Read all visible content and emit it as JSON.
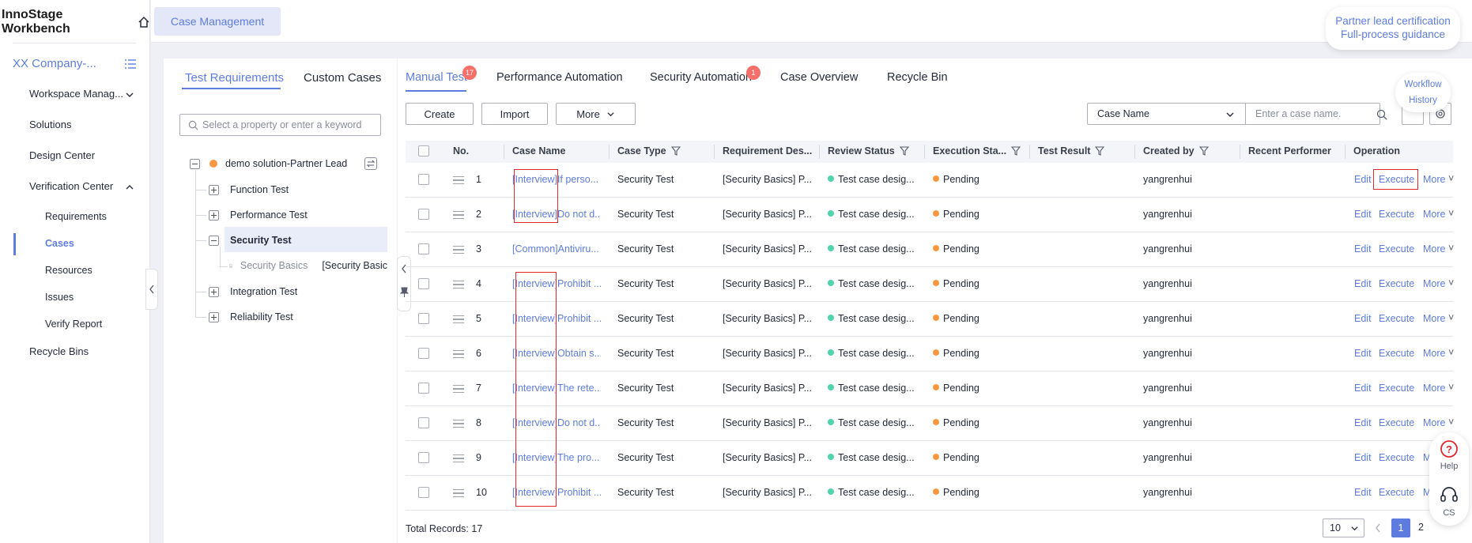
{
  "brand": {
    "title": "InnoStage Workbench"
  },
  "sidebar": {
    "company": "XX Company-...",
    "items": [
      {
        "label": "Workspace Manag..."
      },
      {
        "label": "Solutions"
      },
      {
        "label": "Design Center"
      },
      {
        "label": "Verification Center"
      },
      {
        "label": "Requirements"
      },
      {
        "label": "Cases"
      },
      {
        "label": "Resources"
      },
      {
        "label": "Issues"
      },
      {
        "label": "Verify Report"
      },
      {
        "label": "Recycle Bins"
      }
    ]
  },
  "topbar": {
    "tab": "Case Management",
    "partner_line1": "Partner lead certification",
    "partner_line2": "Full-process guidance"
  },
  "left_panel": {
    "tabs": [
      "Test Requirements",
      "Custom Cases"
    ],
    "search_placeholder": "Select a property or enter a keyword",
    "tree": {
      "root": "demo solution-Partner Lead",
      "children": [
        "Function Test",
        "Performance Test",
        "Security Test",
        "Integration Test",
        "Reliability Test"
      ],
      "security_child_label": "Security Basics",
      "security_child_tag": "[Security Basic"
    }
  },
  "main": {
    "tabs": [
      {
        "label": "Manual Test",
        "badge": "17"
      },
      {
        "label": "Performance Automation",
        "badge": ""
      },
      {
        "label": "Security Automation",
        "badge": "1"
      },
      {
        "label": "Case Overview",
        "badge": ""
      },
      {
        "label": "Recycle Bin",
        "badge": ""
      }
    ],
    "buttons": {
      "create": "Create",
      "import": "Import",
      "more": "More"
    },
    "filter_field": "Case Name",
    "filter_placeholder": "Enter a case name.",
    "workflow_line1": "Workflow",
    "workflow_line2": "History"
  },
  "table": {
    "columns": [
      "No.",
      "Case Name",
      "Case Type",
      "Requirement Des...",
      "Review Status",
      "Execution Sta...",
      "Test Result",
      "Created by",
      "Recent Performer",
      "Operation"
    ],
    "rows": [
      {
        "no": "1",
        "name": "[Interview]If perso...",
        "type": "Security Test",
        "req": "[Security Basics] P...",
        "review": "Test case desig...",
        "exec": "Pending",
        "result": "",
        "created": "yangrenhui",
        "performer": "",
        "ops": [
          "Edit",
          "Execute",
          "More"
        ]
      },
      {
        "no": "2",
        "name": "[Interview]Do not d...",
        "type": "Security Test",
        "req": "[Security Basics] P...",
        "review": "Test case desig...",
        "exec": "Pending",
        "result": "",
        "created": "yangrenhui",
        "performer": "",
        "ops": [
          "Edit",
          "Execute",
          "More"
        ]
      },
      {
        "no": "3",
        "name": "[Common]Antiviru...",
        "type": "Security Test",
        "req": "[Security Basics] P...",
        "review": "Test case desig...",
        "exec": "Pending",
        "result": "",
        "created": "yangrenhui",
        "performer": "",
        "ops": [
          "Edit",
          "Execute",
          "More"
        ]
      },
      {
        "no": "4",
        "name": "[Interview]Prohibit ...",
        "type": "Security Test",
        "req": "[Security Basics] P...",
        "review": "Test case desig...",
        "exec": "Pending",
        "result": "",
        "created": "yangrenhui",
        "performer": "",
        "ops": [
          "Edit",
          "Execute",
          "More"
        ]
      },
      {
        "no": "5",
        "name": "[Interview]Prohibit ...",
        "type": "Security Test",
        "req": "[Security Basics] P...",
        "review": "Test case desig...",
        "exec": "Pending",
        "result": "",
        "created": "yangrenhui",
        "performer": "",
        "ops": [
          "Edit",
          "Execute",
          "More"
        ]
      },
      {
        "no": "6",
        "name": "[Interview]Obtain s...",
        "type": "Security Test",
        "req": "[Security Basics] P...",
        "review": "Test case desig...",
        "exec": "Pending",
        "result": "",
        "created": "yangrenhui",
        "performer": "",
        "ops": [
          "Edit",
          "Execute",
          "More"
        ]
      },
      {
        "no": "7",
        "name": "[Interview]The rete...",
        "type": "Security Test",
        "req": "[Security Basics] P...",
        "review": "Test case desig...",
        "exec": "Pending",
        "result": "",
        "created": "yangrenhui",
        "performer": "",
        "ops": [
          "Edit",
          "Execute",
          "More"
        ]
      },
      {
        "no": "8",
        "name": "[Interview]Do not d...",
        "type": "Security Test",
        "req": "[Security Basics] P...",
        "review": "Test case desig...",
        "exec": "Pending",
        "result": "",
        "created": "yangrenhui",
        "performer": "",
        "ops": [
          "Edit",
          "Execute",
          "More"
        ]
      },
      {
        "no": "9",
        "name": "[Interview]The pro...",
        "type": "Security Test",
        "req": "[Security Basics] P...",
        "review": "Test case desig...",
        "exec": "Pending",
        "result": "",
        "created": "yangrenhui",
        "performer": "",
        "ops": [
          "Edit",
          "Execute",
          "M"
        ]
      },
      {
        "no": "10",
        "name": "[Interview]Prohibit ...",
        "type": "Security Test",
        "req": "[Security Basics] P...",
        "review": "Test case desig...",
        "exec": "Pending",
        "result": "",
        "created": "yangrenhui",
        "performer": "",
        "ops": [
          "Edit",
          "Execute",
          "M"
        ]
      }
    ]
  },
  "footer": {
    "total": "Total Records: 17",
    "page_size": "10",
    "pages": [
      "1",
      "2"
    ]
  },
  "floating": {
    "help": "Help",
    "cs": "CS"
  },
  "colors": {
    "accent": "#5e7ce0",
    "review_dot": "#50d4ab",
    "exec_dot": "#fa9841",
    "highlight": "#e0292c",
    "badge": "#f66f6a"
  }
}
